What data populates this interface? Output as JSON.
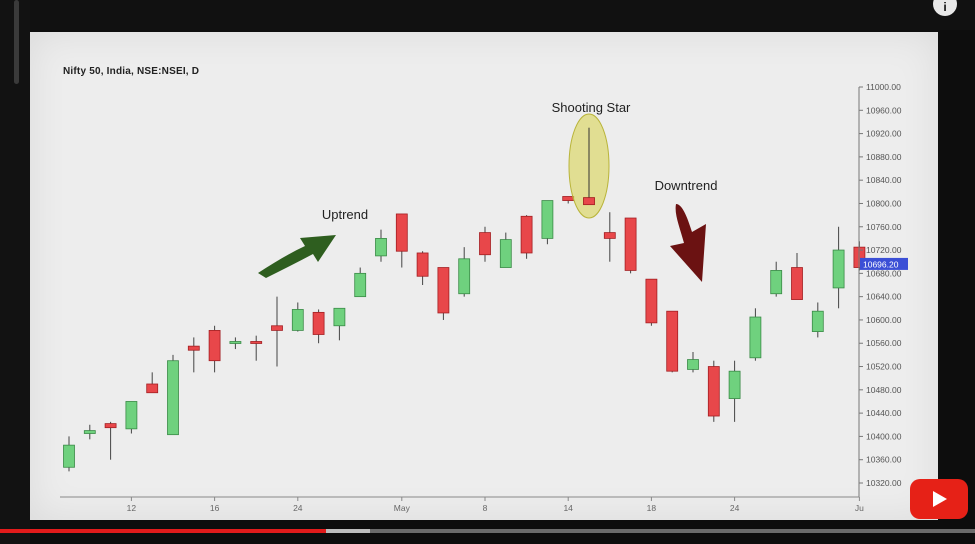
{
  "chart_data": {
    "type": "candlestick",
    "title": "Nifty 50, India, NSE:NSEI, D",
    "ylim": [
      10300,
      11000
    ],
    "y_ticks": [
      "11000.00",
      "10960.00",
      "10920.00",
      "10880.00",
      "10840.00",
      "10800.00",
      "10760.00",
      "10720.00",
      "10680.00",
      "10640.00",
      "10600.00",
      "10560.00",
      "10520.00",
      "10480.00",
      "10440.00",
      "10400.00",
      "10360.00",
      "10320.00"
    ],
    "y_tick_values": [
      11000,
      10960,
      10920,
      10880,
      10840,
      10800,
      10760,
      10720,
      10680,
      10640,
      10600,
      10560,
      10520,
      10480,
      10440,
      10400,
      10360,
      10320
    ],
    "x_ticks": [
      "12",
      "16",
      "24",
      "May",
      "8",
      "14",
      "18",
      "24",
      "Ju"
    ],
    "x_tick_index": [
      3,
      7,
      11,
      16,
      20,
      24,
      28,
      32,
      38
    ],
    "last_price": "10696.20",
    "last_price_value": 10696.2,
    "candles": [
      {
        "o": 10347,
        "h": 10400,
        "l": 10340,
        "c": 10385
      },
      {
        "o": 10405,
        "h": 10420,
        "l": 10395,
        "c": 10410
      },
      {
        "o": 10422,
        "h": 10425,
        "l": 10360,
        "c": 10415
      },
      {
        "o": 10413,
        "h": 10460,
        "l": 10405,
        "c": 10460
      },
      {
        "o": 10490,
        "h": 10510,
        "l": 10475,
        "c": 10475
      },
      {
        "o": 10403,
        "h": 10540,
        "l": 10403,
        "c": 10530
      },
      {
        "o": 10555,
        "h": 10570,
        "l": 10510,
        "c": 10548
      },
      {
        "o": 10582,
        "h": 10590,
        "l": 10510,
        "c": 10530
      },
      {
        "o": 10563,
        "h": 10570,
        "l": 10550,
        "c": 10563
      },
      {
        "o": 10563,
        "h": 10573,
        "l": 10530,
        "c": 10561
      },
      {
        "o": 10590,
        "h": 10640,
        "l": 10520,
        "c": 10582
      },
      {
        "o": 10582,
        "h": 10630,
        "l": 10580,
        "c": 10618
      },
      {
        "o": 10613,
        "h": 10618,
        "l": 10560,
        "c": 10575
      },
      {
        "o": 10590,
        "h": 10620,
        "l": 10565,
        "c": 10620
      },
      {
        "o": 10640,
        "h": 10690,
        "l": 10640,
        "c": 10680
      },
      {
        "o": 10710,
        "h": 10755,
        "l": 10700,
        "c": 10740
      },
      {
        "o": 10782,
        "h": 10782,
        "l": 10690,
        "c": 10718
      },
      {
        "o": 10715,
        "h": 10718,
        "l": 10660,
        "c": 10675
      },
      {
        "o": 10690,
        "h": 10690,
        "l": 10600,
        "c": 10612
      },
      {
        "o": 10645,
        "h": 10725,
        "l": 10640,
        "c": 10705
      },
      {
        "o": 10750,
        "h": 10760,
        "l": 10700,
        "c": 10712
      },
      {
        "o": 10690,
        "h": 10750,
        "l": 10690,
        "c": 10738
      },
      {
        "o": 10778,
        "h": 10780,
        "l": 10705,
        "c": 10715
      },
      {
        "o": 10740,
        "h": 10805,
        "l": 10730,
        "c": 10805
      },
      {
        "o": 10812,
        "h": 10812,
        "l": 10800,
        "c": 10805
      },
      {
        "o": 10810,
        "h": 10930,
        "l": 10800,
        "c": 10798
      },
      {
        "o": 10750,
        "h": 10785,
        "l": 10700,
        "c": 10740
      },
      {
        "o": 10775,
        "h": 10775,
        "l": 10680,
        "c": 10685
      },
      {
        "o": 10670,
        "h": 10670,
        "l": 10590,
        "c": 10595
      },
      {
        "o": 10615,
        "h": 10615,
        "l": 10510,
        "c": 10512
      },
      {
        "o": 10515,
        "h": 10545,
        "l": 10510,
        "c": 10532
      },
      {
        "o": 10520,
        "h": 10530,
        "l": 10425,
        "c": 10435
      },
      {
        "o": 10465,
        "h": 10530,
        "l": 10425,
        "c": 10512
      },
      {
        "o": 10535,
        "h": 10620,
        "l": 10530,
        "c": 10605
      },
      {
        "o": 10645,
        "h": 10700,
        "l": 10640,
        "c": 10685
      },
      {
        "o": 10690,
        "h": 10715,
        "l": 10635,
        "c": 10635
      },
      {
        "o": 10580,
        "h": 10630,
        "l": 10570,
        "c": 10615
      },
      {
        "o": 10655,
        "h": 10760,
        "l": 10620,
        "c": 10720
      },
      {
        "o": 10725,
        "h": 10735,
        "l": 10685,
        "c": 10690
      }
    ],
    "annotations": {
      "uptrend": "Uptrend",
      "shooting_star": "Shooting Star",
      "downtrend": "Downtrend"
    }
  },
  "colors": {
    "bull": "#6fd17e",
    "bear": "#e8474a",
    "bull_stroke": "#3a8a47",
    "bear_stroke": "#a31f22",
    "up_arrow": "#2e5e1f",
    "down_arrow": "#6b1212",
    "highlight": "#d8d355",
    "price_tag": "#3b4fd6"
  },
  "video": {
    "progress_fraction": 0.334,
    "buffer_fraction": 0.38
  },
  "icons": {
    "player_logo": "youtube-play-icon",
    "top_right": "info-icon"
  },
  "top_icon_glyph": "i"
}
